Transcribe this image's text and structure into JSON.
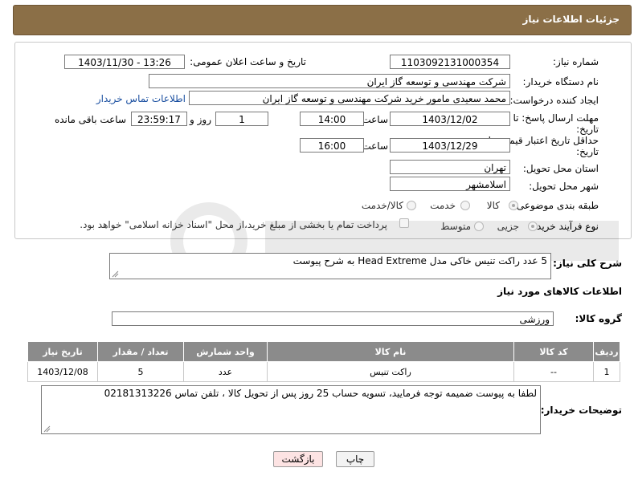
{
  "header": {
    "title": "جزئیات اطلاعات نیاز"
  },
  "form": {
    "need_number_label": "شماره نیاز:",
    "need_number": "1103092131000354",
    "announce_label": "تاریخ و ساعت اعلان عمومی:",
    "announce_value": "1403/11/30 - 13:26",
    "buyer_org_label": "نام دستگاه خریدار:",
    "buyer_org": "شرکت مهندسی و توسعه گاز ایران",
    "creator_label": "ایجاد کننده درخواست:",
    "creator": "محمد سعیدی مامور خرید شرکت مهندسی و توسعه گاز ایران",
    "contact_link": "اطلاعات تماس خریدار",
    "deadline_label_1": "مهلت ارسال پاسخ: تا",
    "deadline_label_2": "تاریخ:",
    "deadline_date": "1403/12/02",
    "time_label": "ساعت",
    "deadline_time": "14:00",
    "days_value": "1",
    "days_label": "روز و",
    "remaining_time": "23:59:17",
    "remaining_label": "ساعت باقی مانده",
    "validity_label_1": "حداقل تاریخ اعتبار قیمت: تا",
    "validity_label_2": "تاریخ:",
    "validity_date": "1403/12/29",
    "validity_time": "16:00",
    "province_label": "استان محل تحویل:",
    "province": "تهران",
    "city_label": "شهر محل تحویل:",
    "city": "اسلامشهر",
    "category_label": "طبقه بندی موضوعی:",
    "category_options": [
      "کالا",
      "خدمت",
      "کالا/خدمت"
    ],
    "category_selected": "کالا",
    "process_label": "نوع فرآیند خرید :",
    "process_options": [
      "جزیی",
      "متوسط"
    ],
    "process_selected": "جزیی",
    "payment_note": "پرداخت تمام یا بخشی از مبلغ خرید،از محل \"اسناد خزانه اسلامی\" خواهد بود."
  },
  "description": {
    "label": "شرح کلی نیاز:",
    "text": "5 عدد راکت تنیس خاکی مدل Head Extreme به شرح پیوست"
  },
  "goods": {
    "section_title": "اطلاعات کالاهای مورد نیاز",
    "group_label": "گروه کالا:",
    "group_value": "ورزشی",
    "columns": [
      "ردیف",
      "کد کالا",
      "نام کالا",
      "واحد شمارش",
      "تعداد / مقدار",
      "تاریخ نیاز"
    ],
    "rows": [
      {
        "row": "1",
        "code": "--",
        "name": "راکت تنیس",
        "unit": "عدد",
        "qty": "5",
        "date": "1403/12/08"
      }
    ]
  },
  "buyer_notes": {
    "label": "توضیحات خریدار:",
    "text": "لطفا به پیوست ضمیمه توجه فرمایید، تسویه حساب 25 روز پس از تحویل کالا ، تلفن تماس 02181313226"
  },
  "buttons": {
    "print": "چاپ",
    "back": "بازگشت"
  },
  "colors": {
    "header_bg": "#8b6f47",
    "table_header_bg": "#8b8b8b",
    "link": "#1a4fa0",
    "back_button_bg": "#fde3e3"
  }
}
